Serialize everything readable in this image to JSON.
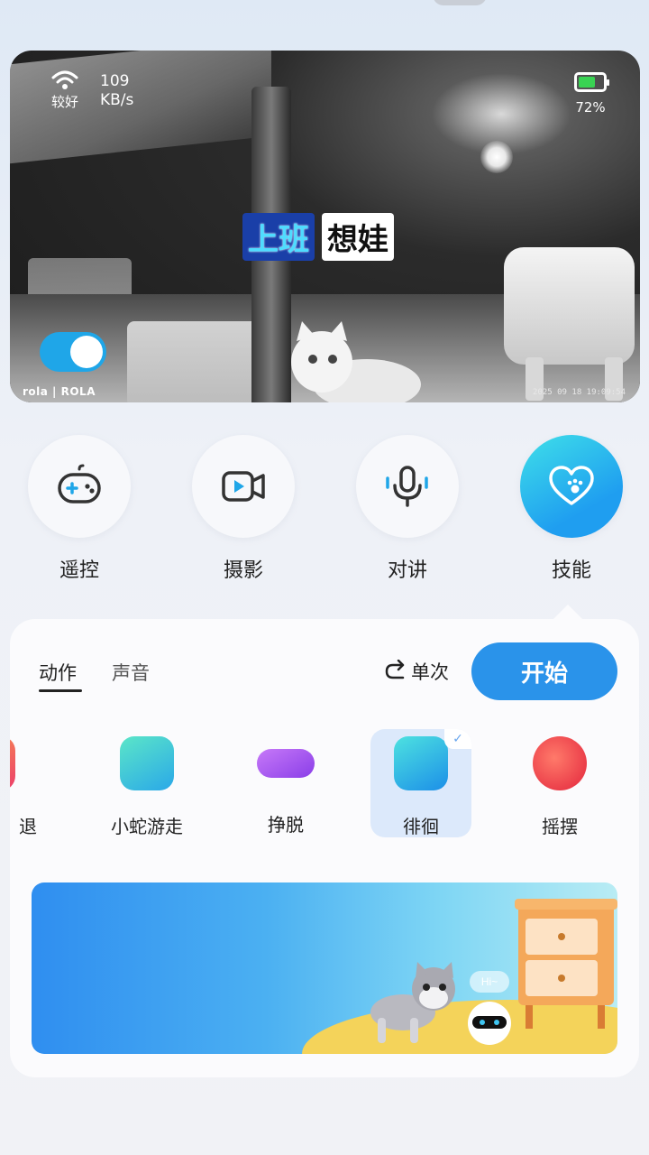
{
  "camera": {
    "signal_label": "较好",
    "speed_value": "109",
    "speed_unit": "KB/s",
    "battery_percent": "72%",
    "battery_level": 0.72,
    "caption_part1": "上班",
    "caption_part2": "想娃",
    "brand": "rola | ROLA",
    "timestamp": "2025 09 18 19:09:54"
  },
  "actions": [
    {
      "label": "遥控",
      "icon": "gamepad-icon"
    },
    {
      "label": "摄影",
      "icon": "video-camera-icon"
    },
    {
      "label": "对讲",
      "icon": "microphone-icon"
    },
    {
      "label": "技能",
      "icon": "heart-paw-icon"
    }
  ],
  "panel": {
    "tabs": [
      "动作",
      "声音"
    ],
    "repeat_label": "单次",
    "start_label": "开始",
    "skills": [
      {
        "label": "退",
        "color": "#ef4f5a"
      },
      {
        "label": "小蛇游走",
        "color": "#3ec9d8"
      },
      {
        "label": "挣脱",
        "color": "#a454f0"
      },
      {
        "label": "徘徊",
        "color": "#2fb4ef"
      },
      {
        "label": "摇摆",
        "color": "#f04848"
      }
    ],
    "banner_bubble": "Hi~"
  }
}
